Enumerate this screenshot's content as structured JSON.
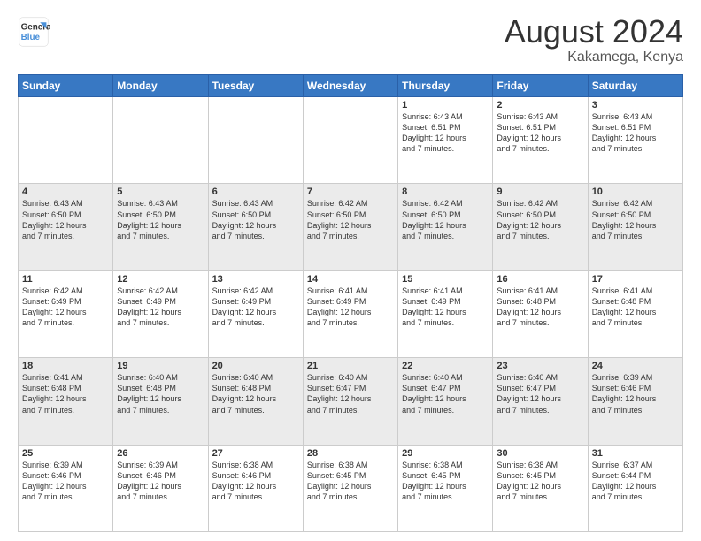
{
  "header": {
    "logo_line1": "General",
    "logo_line2": "Blue",
    "month": "August 2024",
    "location": "Kakamega, Kenya"
  },
  "days_of_week": [
    "Sunday",
    "Monday",
    "Tuesday",
    "Wednesday",
    "Thursday",
    "Friday",
    "Saturday"
  ],
  "weeks": [
    [
      {
        "day": "",
        "info": ""
      },
      {
        "day": "",
        "info": ""
      },
      {
        "day": "",
        "info": ""
      },
      {
        "day": "",
        "info": ""
      },
      {
        "day": "1",
        "info": "Sunrise: 6:43 AM\nSunset: 6:51 PM\nDaylight: 12 hours\nand 7 minutes."
      },
      {
        "day": "2",
        "info": "Sunrise: 6:43 AM\nSunset: 6:51 PM\nDaylight: 12 hours\nand 7 minutes."
      },
      {
        "day": "3",
        "info": "Sunrise: 6:43 AM\nSunset: 6:51 PM\nDaylight: 12 hours\nand 7 minutes."
      }
    ],
    [
      {
        "day": "4",
        "info": "Sunrise: 6:43 AM\nSunset: 6:50 PM\nDaylight: 12 hours\nand 7 minutes."
      },
      {
        "day": "5",
        "info": "Sunrise: 6:43 AM\nSunset: 6:50 PM\nDaylight: 12 hours\nand 7 minutes."
      },
      {
        "day": "6",
        "info": "Sunrise: 6:43 AM\nSunset: 6:50 PM\nDaylight: 12 hours\nand 7 minutes."
      },
      {
        "day": "7",
        "info": "Sunrise: 6:42 AM\nSunset: 6:50 PM\nDaylight: 12 hours\nand 7 minutes."
      },
      {
        "day": "8",
        "info": "Sunrise: 6:42 AM\nSunset: 6:50 PM\nDaylight: 12 hours\nand 7 minutes."
      },
      {
        "day": "9",
        "info": "Sunrise: 6:42 AM\nSunset: 6:50 PM\nDaylight: 12 hours\nand 7 minutes."
      },
      {
        "day": "10",
        "info": "Sunrise: 6:42 AM\nSunset: 6:50 PM\nDaylight: 12 hours\nand 7 minutes."
      }
    ],
    [
      {
        "day": "11",
        "info": "Sunrise: 6:42 AM\nSunset: 6:49 PM\nDaylight: 12 hours\nand 7 minutes."
      },
      {
        "day": "12",
        "info": "Sunrise: 6:42 AM\nSunset: 6:49 PM\nDaylight: 12 hours\nand 7 minutes."
      },
      {
        "day": "13",
        "info": "Sunrise: 6:42 AM\nSunset: 6:49 PM\nDaylight: 12 hours\nand 7 minutes."
      },
      {
        "day": "14",
        "info": "Sunrise: 6:41 AM\nSunset: 6:49 PM\nDaylight: 12 hours\nand 7 minutes."
      },
      {
        "day": "15",
        "info": "Sunrise: 6:41 AM\nSunset: 6:49 PM\nDaylight: 12 hours\nand 7 minutes."
      },
      {
        "day": "16",
        "info": "Sunrise: 6:41 AM\nSunset: 6:48 PM\nDaylight: 12 hours\nand 7 minutes."
      },
      {
        "day": "17",
        "info": "Sunrise: 6:41 AM\nSunset: 6:48 PM\nDaylight: 12 hours\nand 7 minutes."
      }
    ],
    [
      {
        "day": "18",
        "info": "Sunrise: 6:41 AM\nSunset: 6:48 PM\nDaylight: 12 hours\nand 7 minutes."
      },
      {
        "day": "19",
        "info": "Sunrise: 6:40 AM\nSunset: 6:48 PM\nDaylight: 12 hours\nand 7 minutes."
      },
      {
        "day": "20",
        "info": "Sunrise: 6:40 AM\nSunset: 6:48 PM\nDaylight: 12 hours\nand 7 minutes."
      },
      {
        "day": "21",
        "info": "Sunrise: 6:40 AM\nSunset: 6:47 PM\nDaylight: 12 hours\nand 7 minutes."
      },
      {
        "day": "22",
        "info": "Sunrise: 6:40 AM\nSunset: 6:47 PM\nDaylight: 12 hours\nand 7 minutes."
      },
      {
        "day": "23",
        "info": "Sunrise: 6:40 AM\nSunset: 6:47 PM\nDaylight: 12 hours\nand 7 minutes."
      },
      {
        "day": "24",
        "info": "Sunrise: 6:39 AM\nSunset: 6:46 PM\nDaylight: 12 hours\nand 7 minutes."
      }
    ],
    [
      {
        "day": "25",
        "info": "Sunrise: 6:39 AM\nSunset: 6:46 PM\nDaylight: 12 hours\nand 7 minutes."
      },
      {
        "day": "26",
        "info": "Sunrise: 6:39 AM\nSunset: 6:46 PM\nDaylight: 12 hours\nand 7 minutes."
      },
      {
        "day": "27",
        "info": "Sunrise: 6:38 AM\nSunset: 6:46 PM\nDaylight: 12 hours\nand 7 minutes."
      },
      {
        "day": "28",
        "info": "Sunrise: 6:38 AM\nSunset: 6:45 PM\nDaylight: 12 hours\nand 7 minutes."
      },
      {
        "day": "29",
        "info": "Sunrise: 6:38 AM\nSunset: 6:45 PM\nDaylight: 12 hours\nand 7 minutes."
      },
      {
        "day": "30",
        "info": "Sunrise: 6:38 AM\nSunset: 6:45 PM\nDaylight: 12 hours\nand 7 minutes."
      },
      {
        "day": "31",
        "info": "Sunrise: 6:37 AM\nSunset: 6:44 PM\nDaylight: 12 hours\nand 7 minutes."
      }
    ]
  ]
}
